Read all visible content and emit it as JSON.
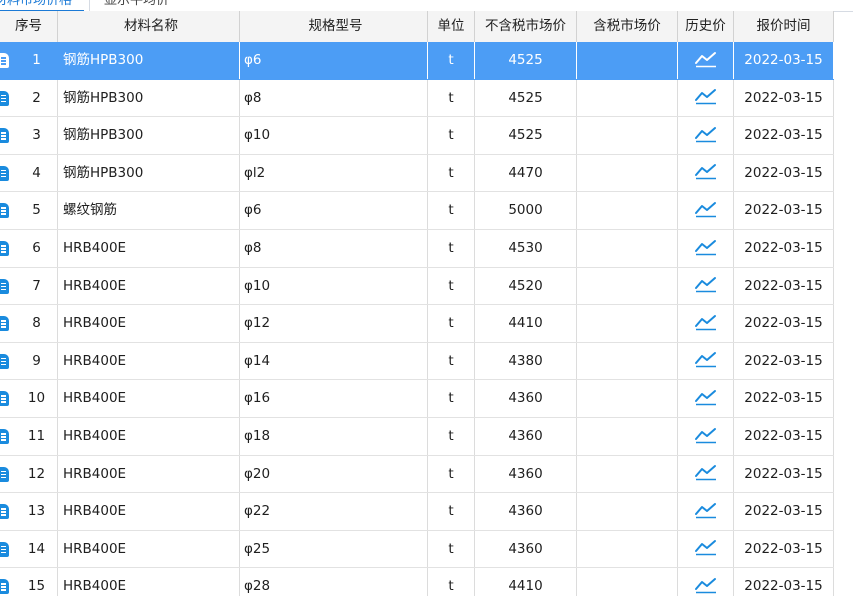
{
  "tabs": [
    {
      "label": "材料市场价格",
      "active": true
    },
    {
      "label": "显示平均价",
      "active": false
    }
  ],
  "table": {
    "columns": {
      "index": "序号",
      "name": "材料名称",
      "spec": "规格型号",
      "unit": "单位",
      "price_excl_tax": "不含税市场价",
      "price_incl_tax": "含税市场价",
      "history": "历史价",
      "quote_date": "报价时间"
    },
    "history_icon": "trend-chart-icon",
    "row_icon": "document-icon",
    "selected_row": 0,
    "rows": [
      {
        "index": "1",
        "name": "钢筋HPB300",
        "spec": "φ6",
        "unit": "t",
        "price_excl_tax": "4525",
        "price_incl_tax": "",
        "quote_date": "2022-03-15"
      },
      {
        "index": "2",
        "name": "钢筋HPB300",
        "spec": "φ8",
        "unit": "t",
        "price_excl_tax": "4525",
        "price_incl_tax": "",
        "quote_date": "2022-03-15"
      },
      {
        "index": "3",
        "name": "钢筋HPB300",
        "spec": "φ10",
        "unit": "t",
        "price_excl_tax": "4525",
        "price_incl_tax": "",
        "quote_date": "2022-03-15"
      },
      {
        "index": "4",
        "name": "钢筋HPB300",
        "spec": "φl2",
        "unit": "t",
        "price_excl_tax": "4470",
        "price_incl_tax": "",
        "quote_date": "2022-03-15"
      },
      {
        "index": "5",
        "name": "螺纹钢筋",
        "spec": "φ6",
        "unit": "t",
        "price_excl_tax": "5000",
        "price_incl_tax": "",
        "quote_date": "2022-03-15"
      },
      {
        "index": "6",
        "name": "HRB400E",
        "spec": "φ8",
        "unit": "t",
        "price_excl_tax": "4530",
        "price_incl_tax": "",
        "quote_date": "2022-03-15"
      },
      {
        "index": "7",
        "name": "HRB400E",
        "spec": "φ10",
        "unit": "t",
        "price_excl_tax": "4520",
        "price_incl_tax": "",
        "quote_date": "2022-03-15"
      },
      {
        "index": "8",
        "name": "HRB400E",
        "spec": "φ12",
        "unit": "t",
        "price_excl_tax": "4410",
        "price_incl_tax": "",
        "quote_date": "2022-03-15"
      },
      {
        "index": "9",
        "name": "HRB400E",
        "spec": "φ14",
        "unit": "t",
        "price_excl_tax": "4380",
        "price_incl_tax": "",
        "quote_date": "2022-03-15"
      },
      {
        "index": "10",
        "name": "HRB400E",
        "spec": "φ16",
        "unit": "t",
        "price_excl_tax": "4360",
        "price_incl_tax": "",
        "quote_date": "2022-03-15"
      },
      {
        "index": "11",
        "name": "HRB400E",
        "spec": "φ18",
        "unit": "t",
        "price_excl_tax": "4360",
        "price_incl_tax": "",
        "quote_date": "2022-03-15"
      },
      {
        "index": "12",
        "name": "HRB400E",
        "spec": "φ20",
        "unit": "t",
        "price_excl_tax": "4360",
        "price_incl_tax": "",
        "quote_date": "2022-03-15"
      },
      {
        "index": "13",
        "name": "HRB400E",
        "spec": "φ22",
        "unit": "t",
        "price_excl_tax": "4360",
        "price_incl_tax": "",
        "quote_date": "2022-03-15"
      },
      {
        "index": "14",
        "name": "HRB400E",
        "spec": "φ25",
        "unit": "t",
        "price_excl_tax": "4360",
        "price_incl_tax": "",
        "quote_date": "2022-03-15"
      },
      {
        "index": "15",
        "name": "HRB400E",
        "spec": "φ28",
        "unit": "t",
        "price_excl_tax": "4410",
        "price_incl_tax": "",
        "quote_date": "2022-03-15"
      }
    ]
  },
  "colors": {
    "selected_row": "#4c9df5",
    "icon_blue": "#1a8bde",
    "header_bg": "#f4f4f4",
    "tab_active": "#1b7ad6"
  }
}
